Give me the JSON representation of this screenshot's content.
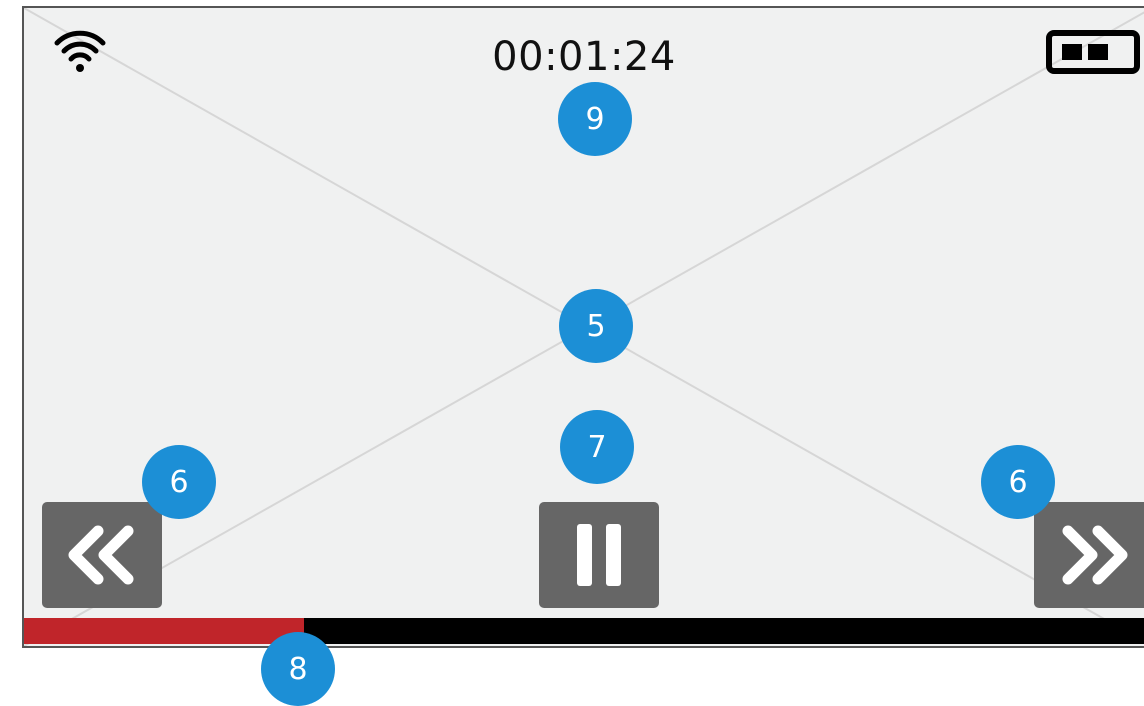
{
  "status_bar": {
    "time": "00:01:24",
    "wifi_icon": "wifi-icon",
    "battery_icon": "battery-icon",
    "battery_level": 0.5
  },
  "media": {
    "placeholder_icon": "image-placeholder-x",
    "progress": 0.25
  },
  "controls": {
    "rewind_icon": "double-chevron-left-icon",
    "pause_icon": "pause-icon",
    "forward_icon": "double-chevron-right-icon"
  },
  "annotations": {
    "timer": "9",
    "media_area": "5",
    "rewind": "6",
    "pause": "7",
    "forward": "6",
    "progress": "8"
  },
  "colors": {
    "screen_bg": "#f0f1f1",
    "control_bg": "#666666",
    "progress_fill": "#c0252a",
    "progress_track": "#000000",
    "annotation_badge": "#1c8fd6"
  }
}
